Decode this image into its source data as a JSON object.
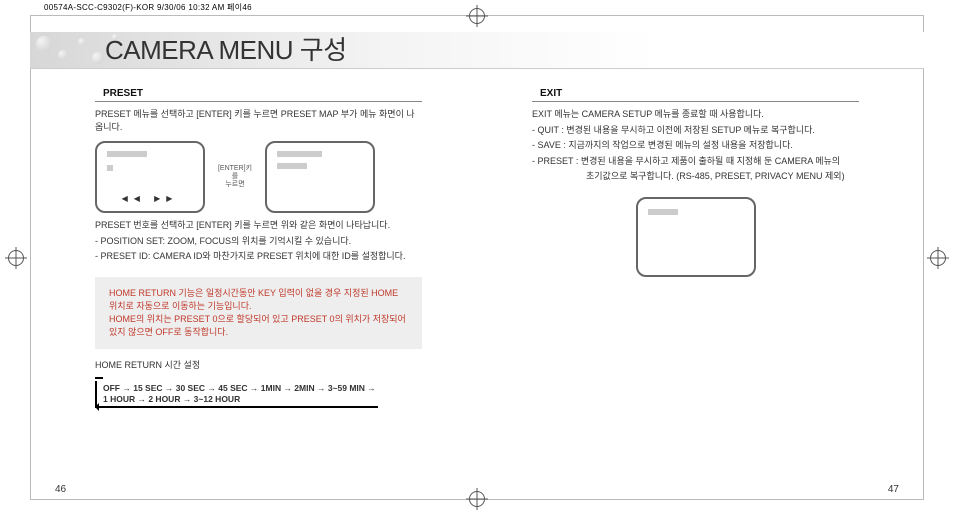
{
  "meta": {
    "header": "00574A-SCC-C9302(F)-KOR  9/30/06 10:32 AM   페이46"
  },
  "title": "CAMERA MENU 구성",
  "left": {
    "section_label": "PRESET",
    "intro": "PRESET 메뉴를 선택하고 [ENTER] 키를 누르면 PRESET MAP 부가 메뉴 화면이 나옵니다.",
    "arrow_label": "[ENTER]키를\n누르면",
    "after_screens_1": "PRESET 번호를 선택하고 [ENTER] 키를 누르면 위와 같은 화면이 나타납니다.",
    "after_screens_2": "- POSITION SET: ZOOM, FOCUS의 위치를 기억시킬 수 있습니다.",
    "after_screens_3": "- PRESET ID: CAMERA ID와 마찬가지로 PRESET 위치에 대한 ID를 설정합니다.",
    "note_1": "HOME RETURN 기능은 일정시간동안 KEY 입력이 없을 경우 지정된 HOME 위치로 자동으로 이동하는 기능입니다.",
    "note_2": "HOME의 위치는 PRESET 0으로 할당되어 있고 PRESET 0의 위치가 저장되어 있지 않으면 OFF로 동작합니다.",
    "hr_title": "HOME RETURN 시간 설정",
    "hr_seq_1": "OFF → 15 SEC → 30 SEC → 45 SEC → 1MIN → 2MIN → 3~59 MIN →",
    "hr_seq_2": "1 HOUR → 2 HOUR → 3~12 HOUR"
  },
  "right": {
    "section_label": "EXIT",
    "line_1": "EXIT 메뉴는 CAMERA SETUP 메뉴를 종료할 때 사용합니다.",
    "line_2": "- QUIT  : 변경된 내용을 무시하고 이전에 저장된 SETUP 메뉴로 복구합니다.",
    "line_3": "- SAVE  : 지금까지의 작업으로 변경된 메뉴의 설정 내용을 저장합니다.",
    "line_4": "- PRESET : 변경된 내용을 무시하고 제품이 출하될 때 지정해 둔 CAMERA 메뉴의",
    "line_5": "초기값으로 복구합니다. (RS-485, PRESET, PRIVACY MENU 제외)"
  },
  "page_left": "46",
  "page_right": "47"
}
